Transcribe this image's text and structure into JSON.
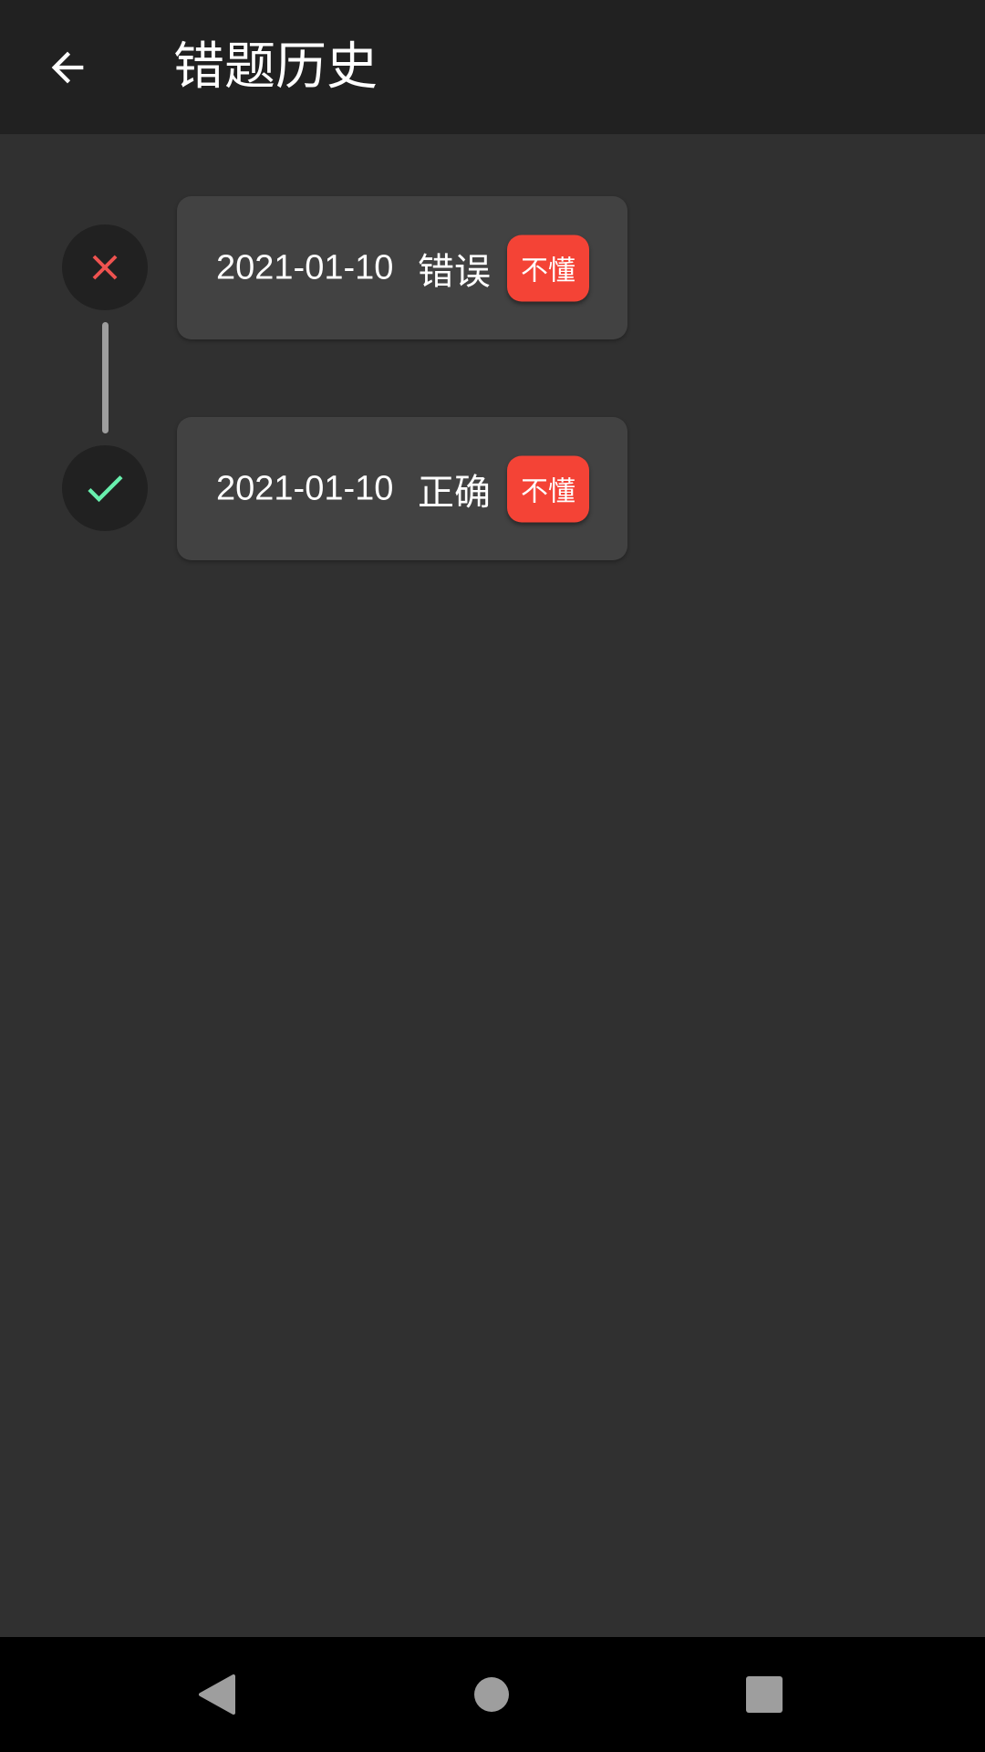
{
  "app_bar": {
    "title": "错题历史",
    "back_icon": "arrow-back-icon"
  },
  "timeline": {
    "records": [
      {
        "date": "2021-01-10",
        "result": "错误",
        "status": "wrong",
        "status_icon": "close-icon",
        "status_color": "#ef5350",
        "tag_label": "不懂"
      },
      {
        "date": "2021-01-10",
        "result": "正确",
        "status": "correct",
        "status_icon": "check-icon",
        "status_color": "#69f0ae",
        "tag_label": "不懂"
      }
    ]
  },
  "nav_bar": {
    "back_icon": "triangle-back-icon",
    "home_icon": "circle-home-icon",
    "recents_icon": "square-recents-icon"
  },
  "colors": {
    "app_bar": "#212121",
    "background": "#303030",
    "card": "#424242",
    "tag": "#f44336"
  }
}
